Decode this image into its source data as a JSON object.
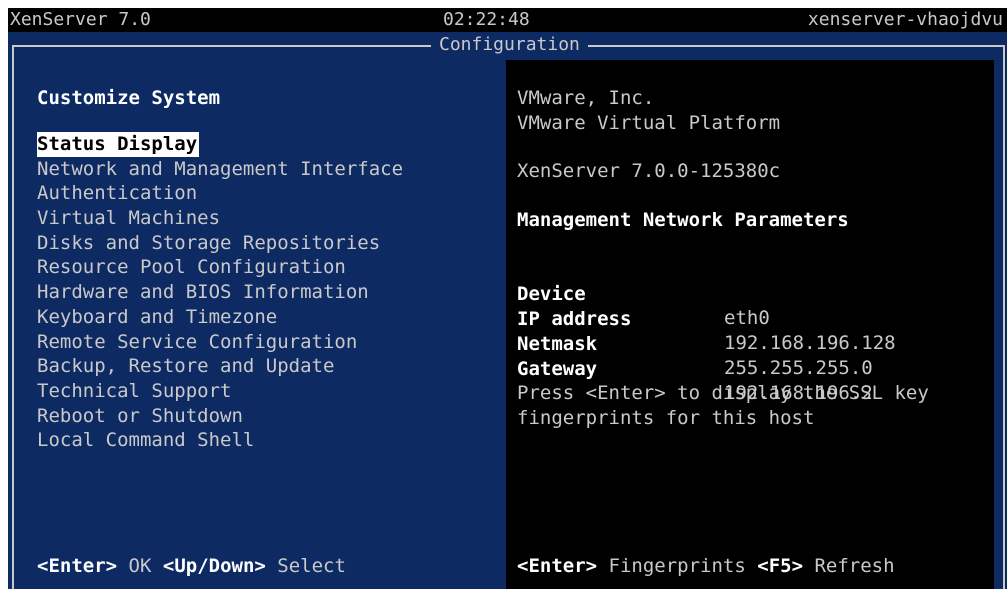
{
  "topbar": {
    "product": "XenServer 7.0",
    "time": "02:22:48",
    "hostname": "xenserver-vhaojdvu"
  },
  "frame": {
    "title": "Configuration"
  },
  "left": {
    "heading": "Customize System",
    "selected_index": 0,
    "menu": [
      "Status Display",
      "Network and Management Interface",
      "Authentication",
      "Virtual Machines",
      "Disks and Storage Repositories",
      "Resource Pool Configuration",
      "Hardware and BIOS Information",
      "Keyboard and Timezone",
      "Remote Service Configuration",
      "Backup, Restore and Update",
      "Technical Support",
      "Reboot or Shutdown",
      "Local Command Shell"
    ],
    "hint": {
      "key1": "<Enter>",
      "action1": "OK",
      "key2": "<Up/Down>",
      "action2": "Select"
    }
  },
  "right": {
    "vendor": "VMware, Inc.",
    "platform": "VMware Virtual Platform",
    "version": "XenServer 7.0.0-125380c",
    "net_heading": "Management Network Parameters",
    "net": [
      {
        "key": "Device",
        "value": "eth0"
      },
      {
        "key": "IP address",
        "value": "192.168.196.128"
      },
      {
        "key": "Netmask",
        "value": "255.255.255.0"
      },
      {
        "key": "Gateway",
        "value": "192.168.196.2"
      }
    ],
    "message_line1": "Press <Enter> to display the SSL key",
    "message_line2": "fingerprints for this host",
    "hint": {
      "key1": "<Enter>",
      "action1": "Fingerprints",
      "key2": "<F5>",
      "action2": "Refresh"
    }
  },
  "colors": {
    "screen_bg": "#0d2a63",
    "panel_bg": "#000000",
    "text": "#c9c9c9",
    "highlight": "#ffffff"
  }
}
